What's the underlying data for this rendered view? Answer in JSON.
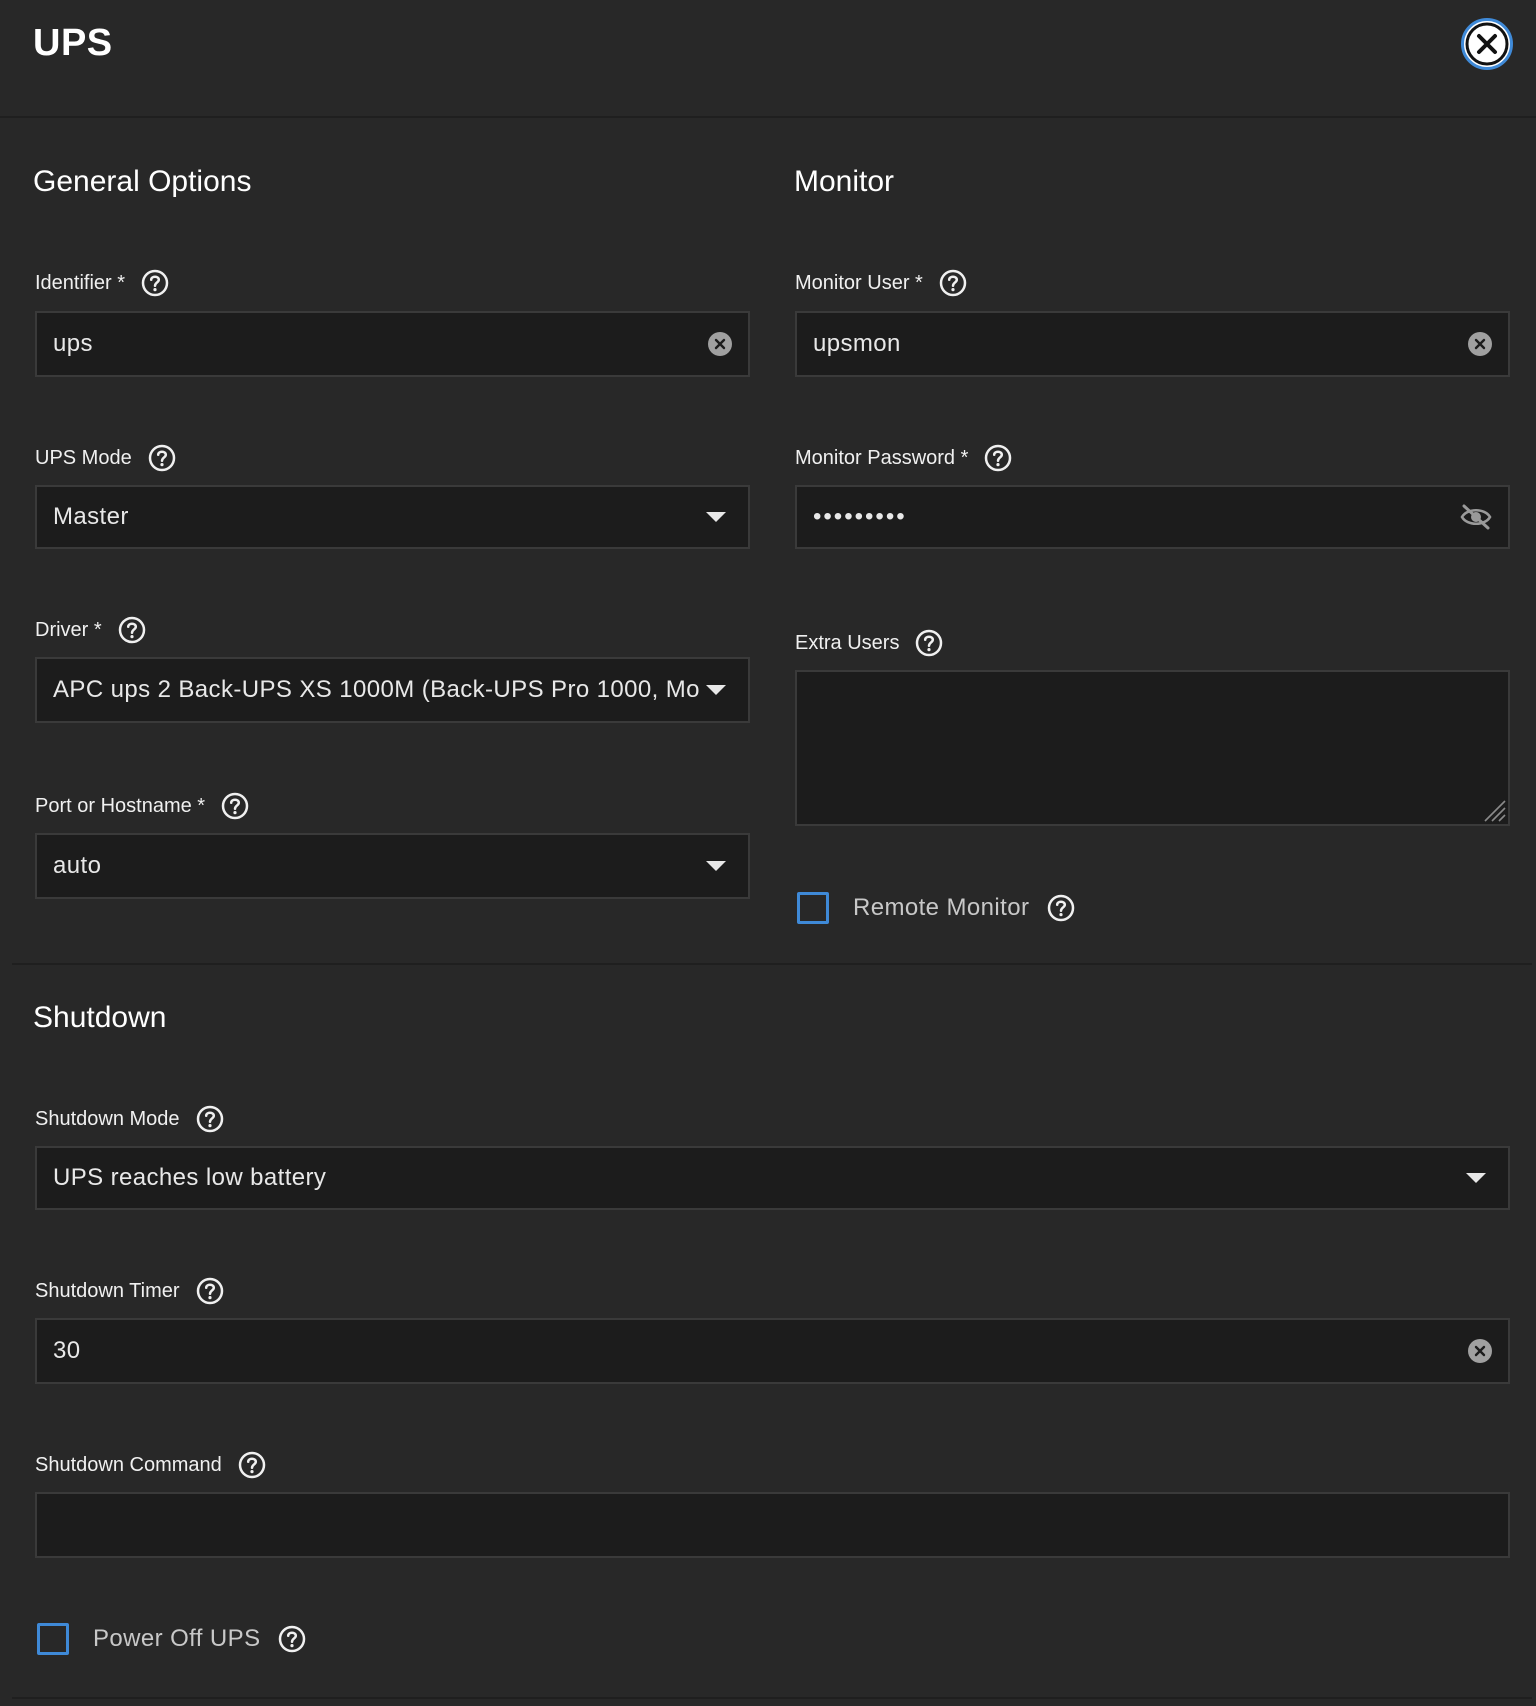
{
  "header": {
    "title": "UPS"
  },
  "general": {
    "title": "General Options",
    "identifier": {
      "label": "Identifier *",
      "value": "ups"
    },
    "ups_mode": {
      "label": "UPS Mode",
      "value": "Master"
    },
    "driver": {
      "label": "Driver *",
      "value": "APC ups 2 Back-UPS XS 1000M (Back-UPS Pro 1000, Mo"
    },
    "port": {
      "label": "Port or Hostname *",
      "value": "auto"
    }
  },
  "monitor": {
    "title": "Monitor",
    "user": {
      "label": "Monitor User *",
      "value": "upsmon"
    },
    "password": {
      "label": "Monitor Password *",
      "value": "•••••••••"
    },
    "extra_users": {
      "label": "Extra Users",
      "value": ""
    },
    "remote_monitor": {
      "label": "Remote Monitor",
      "checked": false
    }
  },
  "shutdown": {
    "title": "Shutdown",
    "mode": {
      "label": "Shutdown Mode",
      "value": "UPS reaches low battery"
    },
    "timer": {
      "label": "Shutdown Timer",
      "value": "30"
    },
    "command": {
      "label": "Shutdown Command",
      "value": ""
    },
    "power_off": {
      "label": "Power Off UPS",
      "checked": false
    }
  },
  "colors": {
    "background": "#282828",
    "input_background": "#1c1c1c",
    "accent": "#3f8ad8",
    "text": "#e6e6e6"
  },
  "icons": {
    "close": "close-icon",
    "help": "help-icon",
    "clear": "clear-icon",
    "dropdown": "chevron-down-icon",
    "visibility": "eye-off-icon"
  }
}
